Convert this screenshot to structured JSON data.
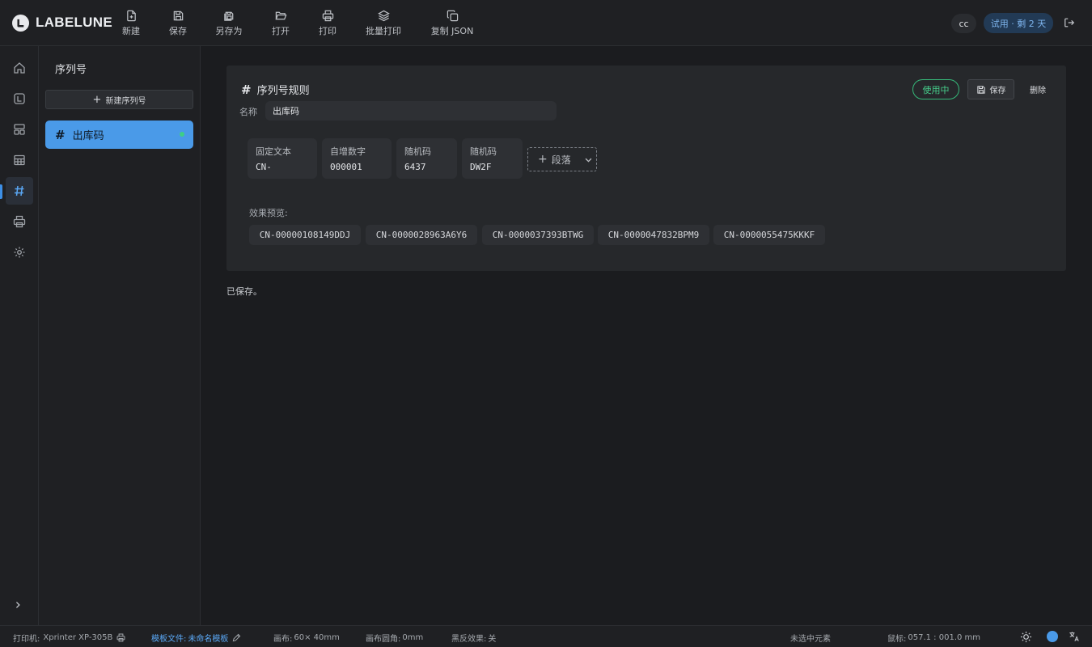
{
  "brand": {
    "name": "LABELUNE",
    "logo_icon": "label-logo-icon"
  },
  "toolbar": [
    {
      "id": "new",
      "label": "新建",
      "icon": "file-plus-icon"
    },
    {
      "id": "save",
      "label": "保存",
      "icon": "floppy-icon"
    },
    {
      "id": "save_as",
      "label": "另存为",
      "icon": "floppy-copy-icon"
    },
    {
      "id": "open",
      "label": "打开",
      "icon": "folder-open-icon"
    },
    {
      "id": "print",
      "label": "打印",
      "icon": "printer-icon"
    },
    {
      "id": "batch_print",
      "label": "批量打印",
      "icon": "layers-icon"
    },
    {
      "id": "copy_json",
      "label": "复制 JSON",
      "icon": "copy-icon"
    }
  ],
  "user": {
    "initials": "cc",
    "trial_badge": "试用 · 剩 2 天"
  },
  "rail": [
    {
      "id": "home",
      "icon": "home-icon",
      "active": false
    },
    {
      "id": "label",
      "icon": "label-icon",
      "active": false
    },
    {
      "id": "templates",
      "icon": "layout-icon",
      "active": false
    },
    {
      "id": "table",
      "icon": "table-icon",
      "active": false
    },
    {
      "id": "serial",
      "icon": "hash-icon",
      "active": true
    },
    {
      "id": "print",
      "icon": "printer-icon",
      "active": false
    },
    {
      "id": "settings",
      "icon": "gear-icon",
      "active": false
    }
  ],
  "panel": {
    "title": "序列号",
    "new_button": "新建序列号",
    "items": [
      {
        "label": "出库码",
        "selected": true,
        "active": true
      }
    ]
  },
  "rule": {
    "title": "序列号规则",
    "name_label": "名称",
    "name_value": "出库码",
    "status": "使用中",
    "save_label": "保存",
    "delete_label": "删除",
    "segments": [
      {
        "type": "固定文本",
        "value": "CN-"
      },
      {
        "type": "自增数字",
        "value": "000001"
      },
      {
        "type": "随机码",
        "value": "6437"
      },
      {
        "type": "随机码",
        "value": "DW2F"
      }
    ],
    "add_segment_label": "段落",
    "preview_label": "效果预览:",
    "preview": [
      "CN-00000108149DDJ",
      "CN-0000028963A6Y6",
      "CN-0000037393BTWG",
      "CN-0000047832BPM9",
      "CN-0000055475KKKF"
    ]
  },
  "saved_message": "已保存。",
  "statusbar": {
    "printer_label": "打印机:",
    "printer_value": "Xprinter XP-305B",
    "template_label": "模板文件:",
    "template_value": "未命名模板",
    "canvas_label": "画布:",
    "canvas_value": "60× 40mm",
    "radius_label": "画布圆角:",
    "radius_value": "0mm",
    "invert_label": "黑反效果:",
    "invert_value": "关",
    "selection": "未选中元素",
    "cursor_label": "鼠标:",
    "cursor_value": "057.1 : 001.0 mm"
  },
  "colors": {
    "accent": "#4a9ae8",
    "success": "#47d08c",
    "background": "#1b1c1f",
    "panel": "#1f2023"
  }
}
